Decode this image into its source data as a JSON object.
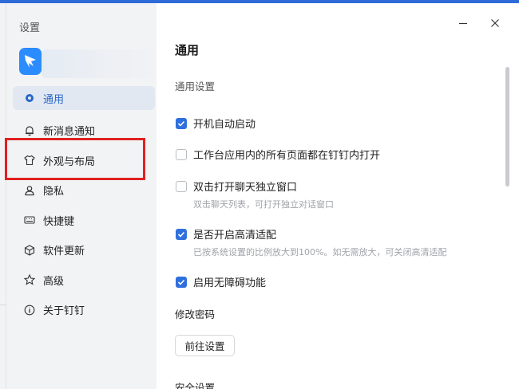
{
  "sidebar": {
    "title": "设置",
    "items": [
      {
        "label": "通用",
        "icon": "general-icon",
        "active": true
      },
      {
        "label": "新消息通知",
        "icon": "bell-icon"
      },
      {
        "label": "外观与布局",
        "icon": "shirt-icon"
      },
      {
        "label": "隐私",
        "icon": "person-icon"
      },
      {
        "label": "快捷键",
        "icon": "keyboard-icon"
      },
      {
        "label": "软件更新",
        "icon": "cube-icon"
      },
      {
        "label": "高级",
        "icon": "star-icon"
      },
      {
        "label": "关于钉钉",
        "icon": "info-icon"
      }
    ]
  },
  "main": {
    "title": "通用",
    "section_general": "通用设置",
    "options": [
      {
        "label": "开机自动启动",
        "checked": true
      },
      {
        "label": "工作台应用内的所有页面都在钉钉内打开",
        "checked": false
      },
      {
        "label": "双击打开聊天独立窗口",
        "checked": false,
        "hint": "双击聊天列表，可打开独立对话窗口"
      },
      {
        "label": "是否开启高清适配",
        "checked": true,
        "hint": "已按系统设置的比例放大到100%。如无需放大，可关闭高清适配"
      },
      {
        "label": "启用无障碍功能",
        "checked": true
      }
    ],
    "section_password": "修改密码",
    "goto_button": "前往设置",
    "section_security": "安全设置"
  },
  "colors": {
    "accent": "#2f6fde",
    "highlight": "#e02020"
  }
}
